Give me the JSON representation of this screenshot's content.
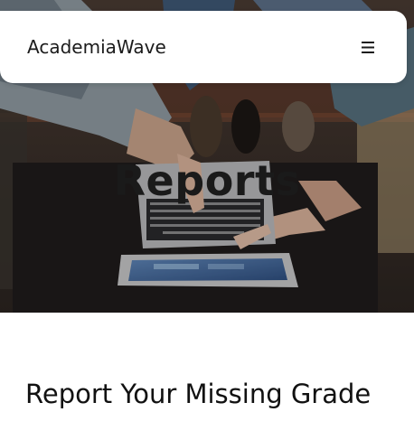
{
  "header": {
    "brand": "AcademiaWave",
    "menu_icon": "hamburger-menu-icon"
  },
  "hero": {
    "title": "Reports",
    "image": "hands-on-laptop-photo"
  },
  "main": {
    "heading": "Report Your Missing Grade"
  },
  "colors": {
    "nav_background": "#ffffff",
    "text": "#1b1b1b",
    "hero_title": "#1a1a1a"
  }
}
